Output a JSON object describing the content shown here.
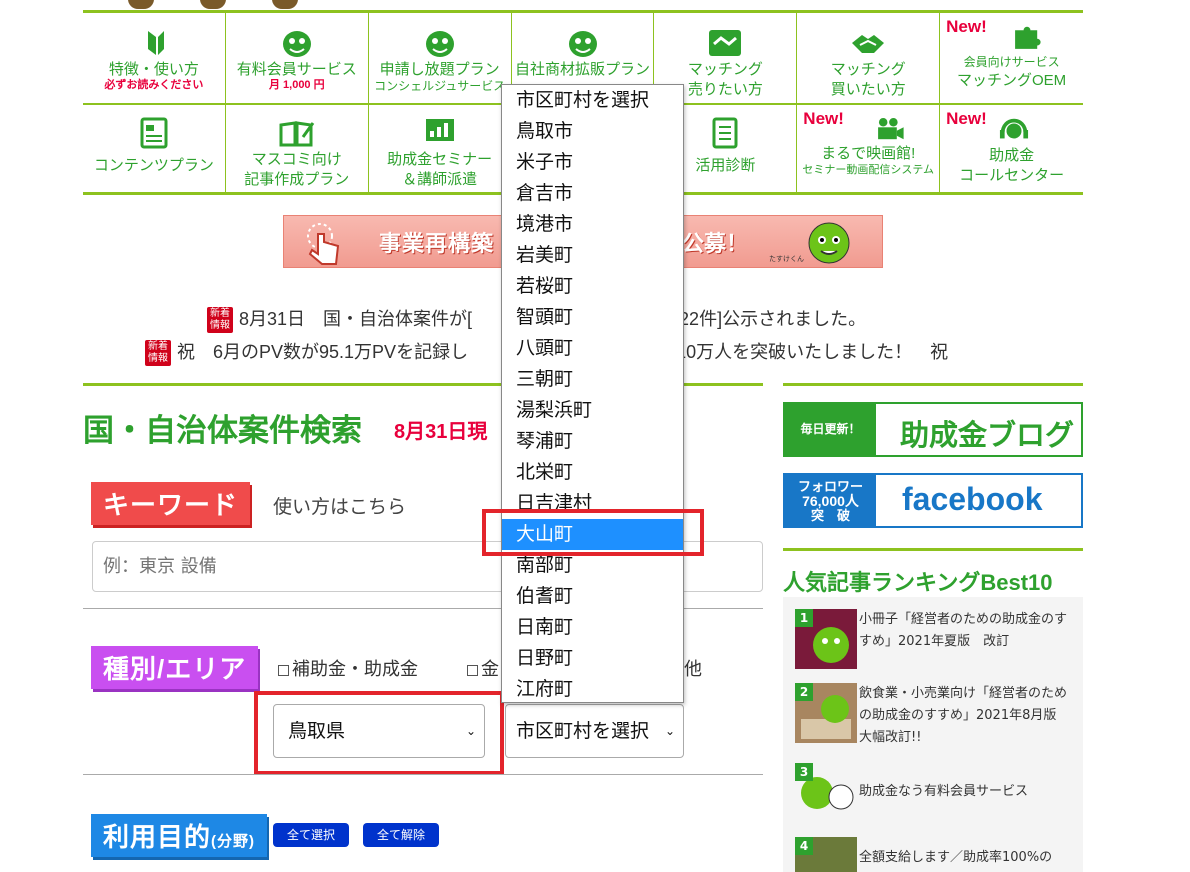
{
  "nav": {
    "row1": [
      {
        "label": "特徴・使い方",
        "sub": "必ずお読みください",
        "icon": "leaf-icon"
      },
      {
        "label": "有料会員サービス",
        "sub": "月 1,000 円",
        "icon": "mascot-icon"
      },
      {
        "label": "申請し放題プラン",
        "sub": "コンシェルジュサービス",
        "icon": "mascot-icon"
      },
      {
        "label": "自社商材拡販プラン",
        "sub": "",
        "icon": "mascot-icon"
      },
      {
        "label": "マッチング",
        "sub": "売りたい方",
        "icon": "handshake-icon"
      },
      {
        "label": "マッチング",
        "sub": "買いたい方",
        "icon": "handshake-icon"
      },
      {
        "label": "会員向けサービス",
        "sub": "マッチングOEM",
        "icon": "puzzle-icon",
        "new": "New!"
      }
    ],
    "row2": [
      {
        "label": "コンテンツプラン",
        "sub": "",
        "icon": "document-icon"
      },
      {
        "label": "マスコミ向け",
        "sub": "記事作成プラン",
        "icon": "book-pen-icon"
      },
      {
        "label": "助成金セミナー",
        "sub": "＆講師派遣",
        "icon": "presentation-icon"
      },
      {
        "label": "",
        "sub": "",
        "icon": ""
      },
      {
        "label": "活用診断",
        "sub": "",
        "icon": "checklist-icon"
      },
      {
        "label": "まるで映画館!",
        "sub": "セミナー動画配信システム",
        "icon": "video-camera-icon",
        "new": "New!"
      },
      {
        "label": "助成金",
        "sub": "コールセンター",
        "icon": "headset-icon",
        "new": "New!"
      }
    ]
  },
  "banner": {
    "left": "事業再構築",
    "right": "公募！",
    "tag": "たすけくん"
  },
  "news": {
    "badge": "新着情報",
    "line1_a": "8月31日　国・自治体案件が[",
    "line1_b": "案件が[22件]公示されました。",
    "line2_a": "祝　6月のPV数が95.1万PVを記録し",
    "line2_b": "数が10万人を突破いたしました！　祝"
  },
  "search": {
    "title": "国・自治体案件検索",
    "date": "8月31日現",
    "keyword_label": "キーワード",
    "howto": "使い方はこちら",
    "keyword_placeholder": "例：東京 設備",
    "area_label": "種別/エリア",
    "check1": "補助金・助成金",
    "check2": "金",
    "check3": "他",
    "pref_value": "鳥取県",
    "muni_value": "市区町村を選択",
    "purpose_label": "利用目的",
    "purpose_sub": "(分野)",
    "select_all": "全て選択",
    "clear_all": "全て解除"
  },
  "dropdown": {
    "items": [
      "市区町村を選択",
      "鳥取市",
      "米子市",
      "倉吉市",
      "境港市",
      "岩美町",
      "若桜町",
      "智頭町",
      "八頭町",
      "三朝町",
      "湯梨浜町",
      "琴浦町",
      "北栄町",
      "日吉津村",
      "大山町",
      "南部町",
      "伯耆町",
      "日南町",
      "日野町",
      "江府町"
    ],
    "selected_index": 14
  },
  "sidebar": {
    "blog_label": "毎日更新！",
    "blog_title": "助成金ブログ",
    "fb_label_1": "フォロワー",
    "fb_label_2": "76,000人",
    "fb_label_3": "突　破",
    "fb_title": "facebook",
    "ranking_title": "人気記事ランキングBest10",
    "ranking": [
      {
        "num": "1",
        "text": "小冊子「経営者のための助成金のすすめ」2021年夏版　改訂"
      },
      {
        "num": "2",
        "text": "飲食業・小売業向け「経営者のための助成金のすすめ」2021年8月版　大幅改訂!!"
      },
      {
        "num": "3",
        "text": "助成金なう有料会員サービス"
      },
      {
        "num": "4",
        "text": "全額支給します／助成率100%の"
      }
    ]
  },
  "colors": {
    "green": "#2ea12e",
    "lime": "#8dc21f",
    "red": "#e8003c",
    "highlight": "#1e90ff",
    "frame": "#e3242b"
  }
}
